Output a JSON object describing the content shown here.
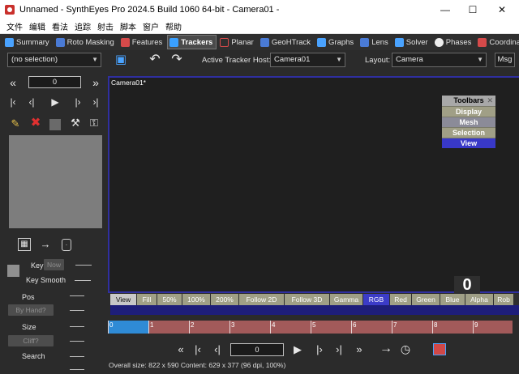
{
  "window": {
    "title": "Unnamed - SynthEyes Pro 2024.5 Build 1060 64-bit - Camera01 -",
    "minimize": "—",
    "maximize": "☐",
    "close": "✕"
  },
  "menu": [
    "文件",
    "编辑",
    "看法",
    "追踪",
    "射击",
    "脚本",
    "窗户",
    "帮助"
  ],
  "tabs": [
    {
      "label": "Summary",
      "icon": "sigma-icon",
      "color": "#4aa3ff"
    },
    {
      "label": "Roto Masking",
      "icon": "roto-icon",
      "color": "#4a7bd6"
    },
    {
      "label": "Features",
      "icon": "features-icon",
      "color": "#d64a4a"
    },
    {
      "label": "Trackers",
      "icon": "trackers-icon",
      "color": "#3aa0ff",
      "active": true
    },
    {
      "label": "Planar",
      "icon": "planar-icon",
      "color": "#d64a4a"
    },
    {
      "label": "GeoHTrack",
      "icon": "geohtrack-icon",
      "color": "#4a7bd6"
    },
    {
      "label": "Graphs",
      "icon": "graphs-icon",
      "color": "#4aa3ff"
    },
    {
      "label": "Lens",
      "icon": "lens-icon",
      "color": "#4a7bd6"
    },
    {
      "label": "Solver",
      "icon": "solver-icon",
      "color": "#4aa3ff"
    },
    {
      "label": "Phases",
      "icon": "phases-icon",
      "color": "#eeeeee"
    },
    {
      "label": "Coordina",
      "icon": "coordinate-icon",
      "color": "#d64a4a"
    }
  ],
  "toolbar": {
    "selection": "(no selection)",
    "tracker_host_label": "Active Tracker Host:",
    "tracker_host": "Camera01",
    "layout_label": "Layout:",
    "layout": "Camera",
    "msg": "Msg"
  },
  "left": {
    "frame": "0",
    "key_label": "Key",
    "now_btn": "Now",
    "key_smooth_label": "Key Smooth",
    "pos_label": "Pos",
    "by_hand_btn": "By Hand?",
    "size_label": "Size",
    "cliff_btn": "Cliff?",
    "search_label": "Search"
  },
  "viewport": {
    "title": "Camera01*",
    "big_frame": "0"
  },
  "toolbars_panel": {
    "title": "Toolbars",
    "close": "✕",
    "items": [
      "Display",
      "Mesh",
      "Selection",
      "View"
    ]
  },
  "viewbar": [
    "View",
    "Fill",
    "50%",
    "100%",
    "200%",
    "Follow 2D",
    "Follow 3D",
    "Gamma",
    "RGB",
    "Red",
    "Green",
    "Blue",
    "Alpha",
    "Rob"
  ],
  "timebar": {
    "labels": [
      "0",
      "1",
      "2",
      "3",
      "4",
      "5",
      "6",
      "7",
      "8",
      "9"
    ],
    "current": 0
  },
  "playback": {
    "frame": "0"
  },
  "status": "Overall size: 822 x 590  Content: 629 x 377 (96 dpi, 100%)"
}
